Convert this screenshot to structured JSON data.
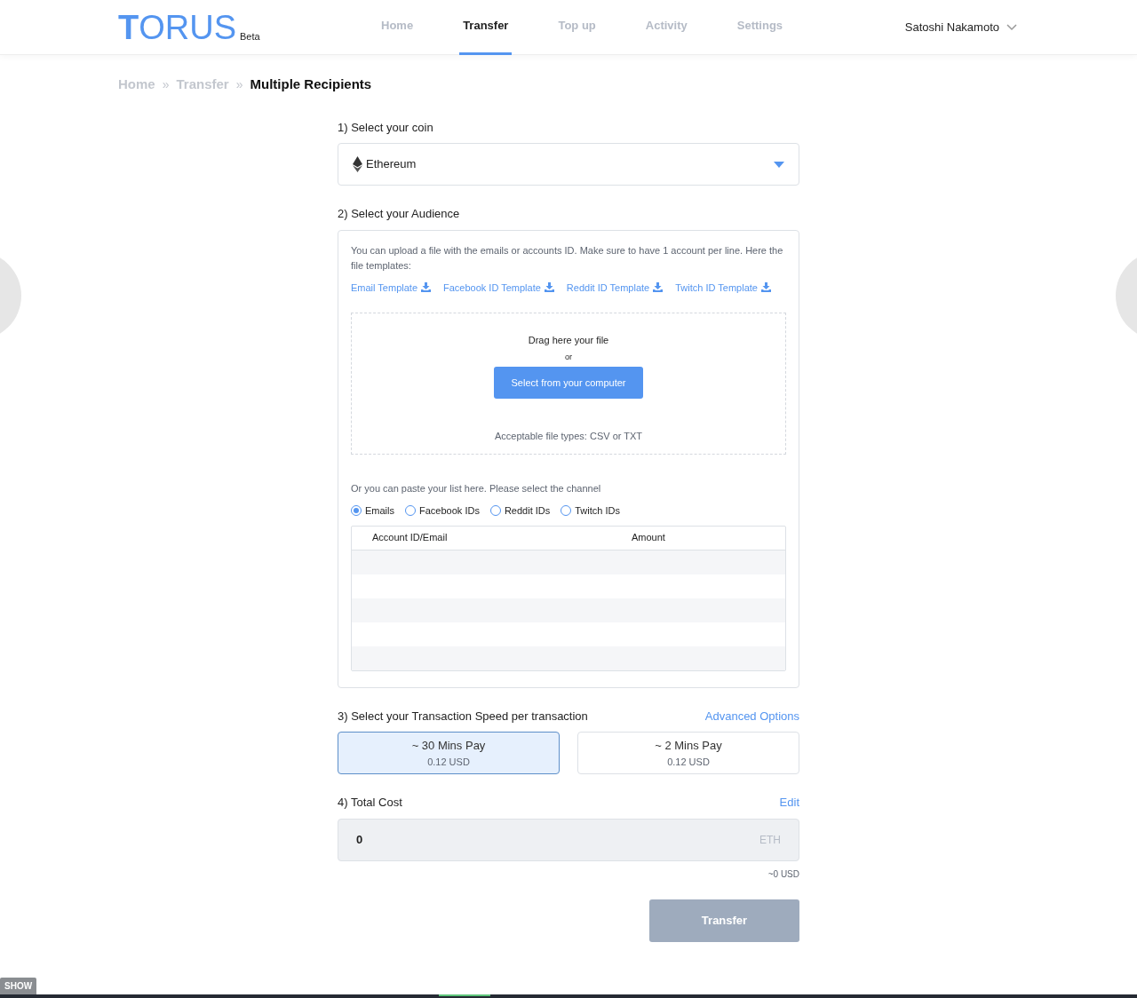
{
  "brand": {
    "logo": "TORUS",
    "tag": "Beta"
  },
  "nav": [
    {
      "label": "Home",
      "selected": false
    },
    {
      "label": "Transfer",
      "selected": true
    },
    {
      "label": "Top up",
      "selected": false
    },
    {
      "label": "Activity",
      "selected": false
    },
    {
      "label": "Settings",
      "selected": false
    }
  ],
  "user": {
    "name": "Satoshi Nakamoto"
  },
  "breadcrumb": [
    {
      "label": "Home",
      "current": false
    },
    {
      "separator": "»",
      "label": "Transfer",
      "current": false
    },
    {
      "separator": "»",
      "label": "Multiple Recipients",
      "current": true
    }
  ],
  "coin": {
    "label": "1) Select your coin",
    "value": "Ethereum"
  },
  "audience": {
    "label": "2) Select your Audience",
    "intro": "You can upload a file with the emails or accounts ID. Make sure to have 1 account per line. Here the file templates:",
    "templates": [
      "Email Template",
      "Facebook ID Template",
      "Reddit ID Template",
      "Twitch ID Template"
    ],
    "drop": {
      "title": "Drag here your file",
      "or": "or",
      "button": "Select from your computer",
      "types": "Acceptable file types: CSV or TXT"
    },
    "paste_hint": "Or you can paste your list here. Please select the channel",
    "channels": [
      {
        "label": "Emails",
        "selected": true
      },
      {
        "label": "Facebook IDs",
        "selected": false
      },
      {
        "label": "Reddit IDs",
        "selected": false
      },
      {
        "label": "Twitch IDs",
        "selected": false
      }
    ],
    "table": {
      "columns": [
        "Account ID/Email",
        "Amount"
      ]
    }
  },
  "speed": {
    "label": "3) Select your Transaction Speed per transaction",
    "link": "Advanced Options",
    "options": [
      {
        "title": "~ 30 Mins Pay",
        "price": "0.12 USD",
        "selected": true
      },
      {
        "title": "~ 2 Mins Pay",
        "price": "0.12 USD",
        "selected": false
      }
    ]
  },
  "total": {
    "label": "4) Total Cost",
    "link": "Edit",
    "value": "0",
    "unit": "ETH",
    "usd": "~0 USD"
  },
  "transfer_button": {
    "label": "Transfer",
    "disabled": true
  },
  "bottom_bar": {
    "toggle": "SHOW"
  }
}
